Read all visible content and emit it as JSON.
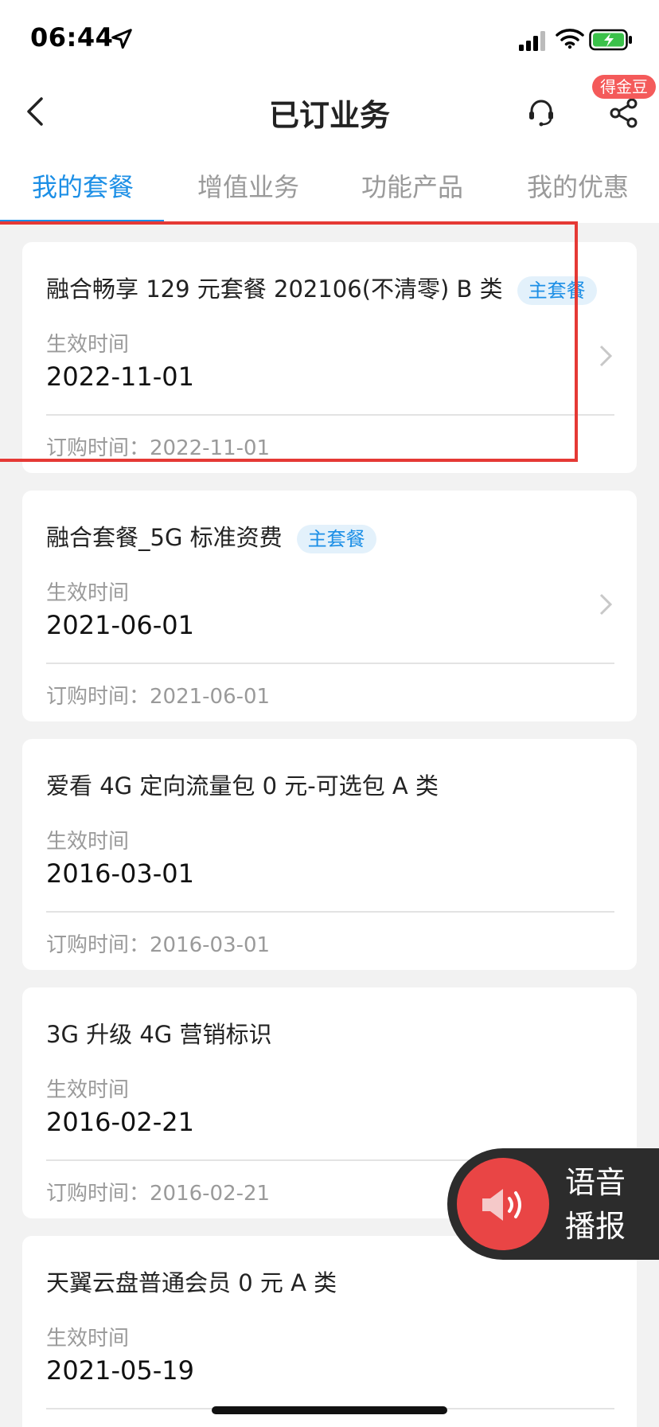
{
  "status_bar": {
    "time": "06:44"
  },
  "header": {
    "title": "已订业务",
    "badge": "得金豆",
    "tabs": [
      {
        "label": "我的套餐"
      },
      {
        "label": "增值业务"
      },
      {
        "label": "功能产品"
      },
      {
        "label": "我的优惠"
      }
    ],
    "active_tab": 0
  },
  "labels": {
    "effective_time": "生效时间",
    "order_time_prefix": "订购时间："
  },
  "cards": [
    {
      "title": "融合畅享 129 元套餐 202106(不清零) B 类",
      "tag": "主套餐",
      "effective_date": "2022-11-01",
      "order_time": "订购时间：2022-11-01"
    },
    {
      "title": "融合套餐_5G 标准资费",
      "tag": "主套餐",
      "effective_date": "2021-06-01",
      "order_time": "订购时间：2021-06-01"
    },
    {
      "title": "爱看 4G 定向流量包 0 元-可选包 A 类",
      "tag": "",
      "effective_date": "2016-03-01",
      "order_time": "订购时间：2016-03-01"
    },
    {
      "title": "3G 升级 4G 营销标识",
      "tag": "",
      "effective_date": "2016-02-21",
      "order_time": "订购时间：2016-02-21"
    },
    {
      "title": "天翼云盘普通会员 0 元 A 类",
      "tag": "",
      "effective_date": "2021-05-19",
      "order_time": ""
    }
  ],
  "voice_button": {
    "label": "语音播报"
  },
  "colors": {
    "accent": "#1c8fe6",
    "highlight": "#e53935",
    "badge": "#f45a5a"
  },
  "icons": [
    "location-arrow-icon",
    "signal-icon",
    "wifi-icon",
    "battery-charging-icon",
    "back-icon",
    "customer-service-icon",
    "share-icon",
    "chevron-right-icon",
    "speaker-icon"
  ]
}
